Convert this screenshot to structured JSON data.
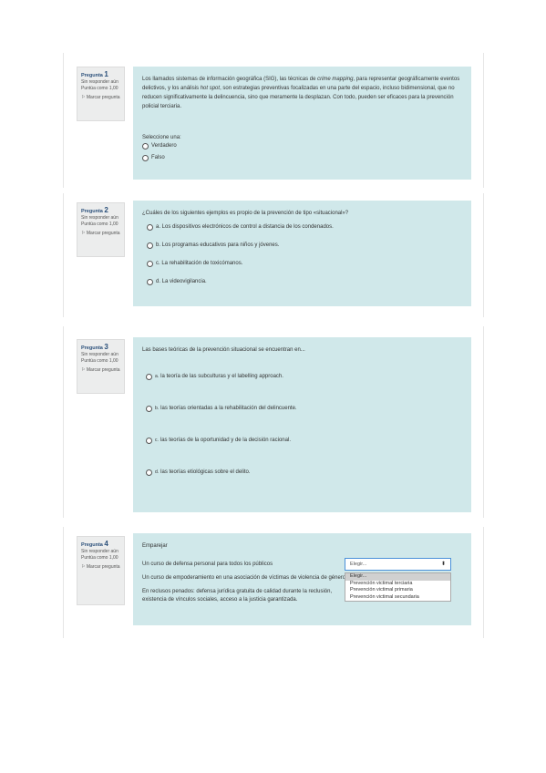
{
  "questions": [
    {
      "label": "Pregunta",
      "number": "1",
      "status": "Sin responder aún",
      "score": "Puntúa como 1,00",
      "flag": "Marcar pregunta",
      "text_a": "Los llamados sistemas de información geográfica (SIG), las técnicas de ",
      "text_b": "crime mapping",
      "text_c": ", para representar geográficamente eventos delictivos, y los análisis ",
      "text_d": "hot spot",
      "text_e": ", son estrategias preventivas focalizadas en una parte del espacio, incluso bidimensional, que no reducen significativamente la delincuencia, sino que meramente la desplazan. Con todo, pueden ser eficaces para la prevención policial terciaria.",
      "prompt": "Seleccione una:",
      "options": [
        "Verdadero",
        "Falso"
      ]
    },
    {
      "label": "Pregunta",
      "number": "2",
      "status": "Sin responder aún",
      "score": "Puntúa como 1,00",
      "flag": "Marcar pregunta",
      "text": "¿Cuáles de los siguientes ejemplos es propio de la prevención de tipo «situacional»?",
      "options": [
        "a. Los dispositivos electrónicos de control a distancia de los condenados.",
        "b. Los programas educativos para niños y jóvenes.",
        "c. La rehabilitación de toxicómanos.",
        "d. La videovigilancia."
      ]
    },
    {
      "label": "Pregunta",
      "number": "3",
      "status": "Sin responder aún",
      "score": "Puntúa como 1,00",
      "flag": "Marcar pregunta",
      "text": "Las bases teóricas de la prevención situacional se encuentran en...",
      "options": [
        {
          "letter": "a.",
          "text": "la teoría de las subculturas y el labelling approach."
        },
        {
          "letter": "b.",
          "text": "las teorías orientadas a la rehabilitación del delincuente."
        },
        {
          "letter": "c.",
          "text": "las teorías de la oportunidad y de la decisión racional."
        },
        {
          "letter": "d.",
          "text": "las teorías etiológicas sobre el delito."
        }
      ]
    },
    {
      "label": "Pregunta",
      "number": "4",
      "status": "Sin responder aún",
      "score": "Puntúa como 1,00",
      "flag": "Marcar pregunta",
      "text": "Emparejar",
      "items": [
        "Un curso de defensa personal para todos los públicos",
        "Un curso de empoderamiento en una asociación de víctimas de violencia de género",
        "En reclusos penados: defensa jurídica gratuita de calidad durante la reclusión, existencia de vínculos sociales, acceso a la justicia garantizada."
      ],
      "select_value": "Elegir...",
      "dropdown_options": [
        "Elegir...",
        "Prevención victimal terciaria",
        "Prevención victimal primaria",
        "Prevención victimal secundaria"
      ]
    }
  ],
  "icons": {
    "flag": "flag-icon",
    "select_arrow": "updown-arrow-icon"
  },
  "colors": {
    "content_bg": "#d0e8ea",
    "info_bg": "#eceded",
    "select_border": "#4a90d9"
  }
}
